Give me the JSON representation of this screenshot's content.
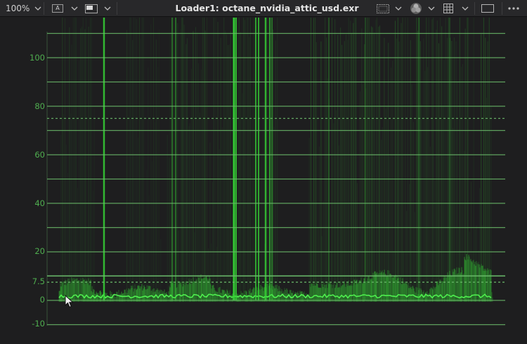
{
  "toolbar": {
    "zoom": "100%",
    "title": "Loader1: octane_nvidia_attic_usd.exr"
  },
  "icons": {
    "zoom_dropdown": "chevron-down-icon",
    "channel_a": "channel-a-icon",
    "viewer_mode": "viewer-mode-icon",
    "scope_type": "waveform-scope-icon",
    "color_wheel": "color-wheel-icon",
    "grid": "grid-icon",
    "single_view": "single-view-icon",
    "more": "more-options-icon"
  },
  "channel_label": "A",
  "scope": {
    "type": "waveform",
    "color": "#36d436",
    "graticule_color": "#6ab86a",
    "y_ticks": [
      "110",
      "100",
      "90",
      "80",
      "70",
      "60",
      "50",
      "40",
      "30",
      "20",
      "10",
      "7.5",
      "0",
      "-10"
    ],
    "y_labels": [
      "100",
      "80",
      "60",
      "40",
      "20",
      "7.5",
      "0",
      "-10"
    ],
    "dashed_levels": [
      "75",
      "7.5"
    ]
  }
}
